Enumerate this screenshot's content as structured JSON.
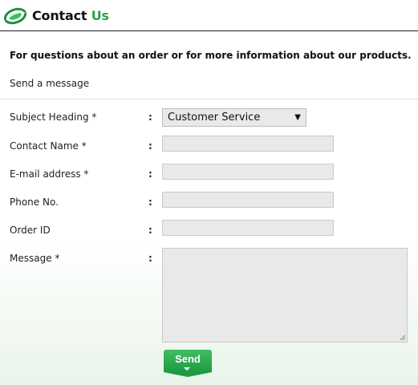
{
  "header": {
    "title_part1": "Contact ",
    "title_part2": "Us",
    "accent_color": "#2aa14a"
  },
  "intro": {
    "heading": "For questions about an order or for more information about our products.",
    "subheading": "Send a message"
  },
  "form": {
    "subject": {
      "label": "Subject Heading *",
      "colon": ":",
      "selected": "Customer Service",
      "arrow": "▼"
    },
    "name": {
      "label": "Contact Name *",
      "colon": ":",
      "value": ""
    },
    "email": {
      "label": "E-mail address *",
      "colon": ":",
      "value": ""
    },
    "phone": {
      "label": "Phone No.",
      "colon": ":",
      "value": ""
    },
    "order": {
      "label": "Order ID",
      "colon": ":",
      "value": ""
    },
    "message": {
      "label": "Message *",
      "colon": ":",
      "value": ""
    },
    "send_label": "Send"
  }
}
